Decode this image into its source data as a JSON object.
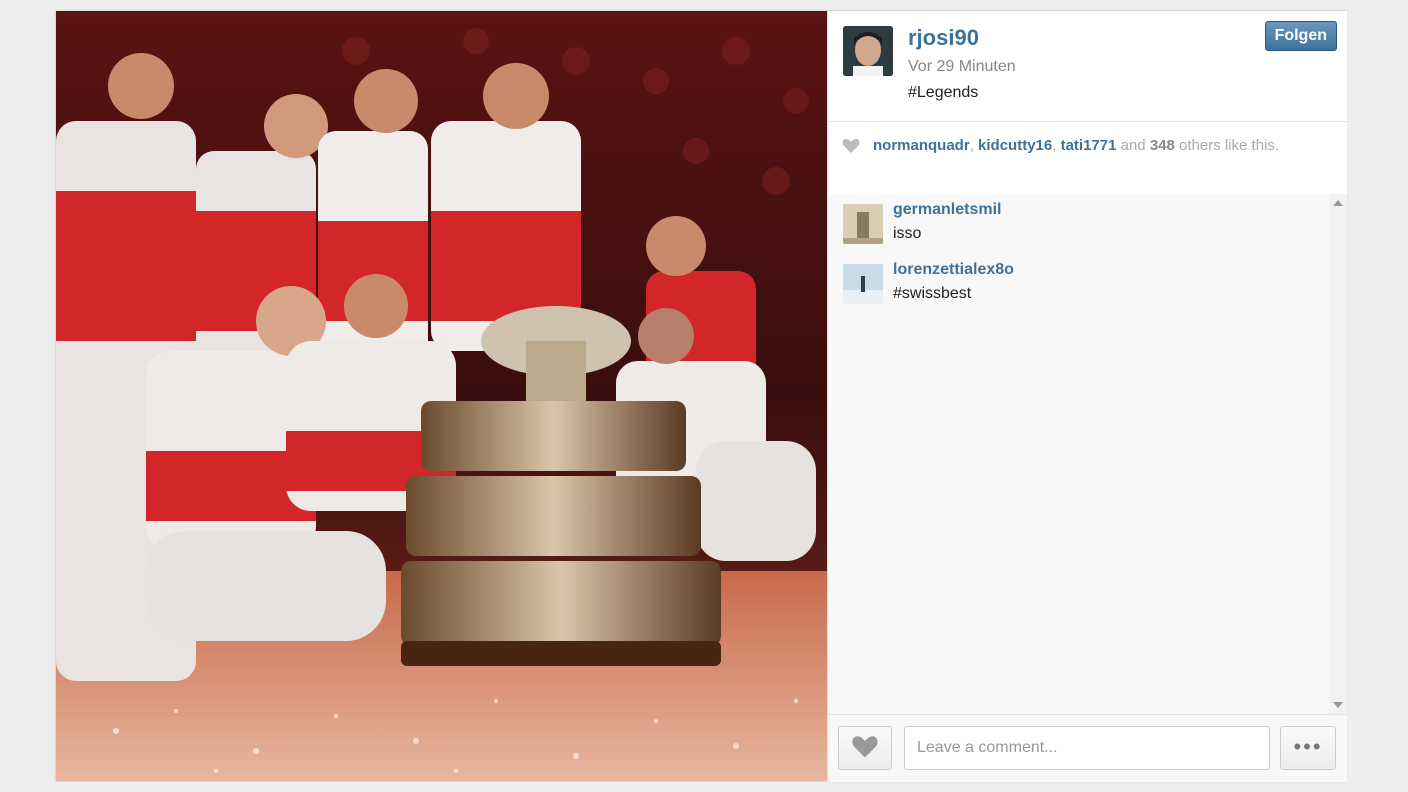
{
  "post": {
    "photo_description_icon": "photo",
    "username": "rjosi90",
    "timestamp": "Vor 29 Minuten",
    "caption": "#Legends",
    "follow_label": "Folgen"
  },
  "likes": {
    "likers": [
      "normanquadr",
      "kidcutty16",
      "tati1771"
    ],
    "separator": ", ",
    "and_text": " and ",
    "count": "348",
    "suffix": " others like this."
  },
  "comments": [
    {
      "user": "germanletsmil",
      "text": "isso"
    },
    {
      "user": "lorenzettialex8o",
      "text": "#swissbest"
    }
  ],
  "footer": {
    "comment_placeholder": "Leave a comment...",
    "more_label": "•••"
  },
  "colors": {
    "link": "#3f729b",
    "follow_button": "#3f729b"
  }
}
